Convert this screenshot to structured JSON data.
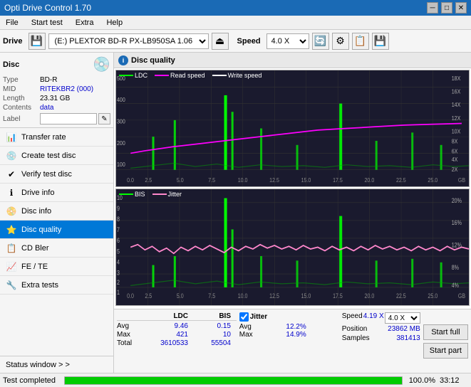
{
  "titlebar": {
    "title": "Opti Drive Control 1.70",
    "min_btn": "─",
    "max_btn": "□",
    "close_btn": "✕"
  },
  "menubar": {
    "items": [
      "File",
      "Start test",
      "Extra",
      "Help"
    ]
  },
  "toolbar": {
    "drive_label": "Drive",
    "drive_value": "(E:) PLEXTOR BD-R  PX-LB950SA 1.06",
    "speed_label": "Speed",
    "speed_value": "4.0 X"
  },
  "sidebar": {
    "disc_title": "Disc",
    "disc_type_label": "Type",
    "disc_type_value": "BD-R",
    "disc_mid_label": "MID",
    "disc_mid_value": "RITEKBR2 (000)",
    "disc_length_label": "Length",
    "disc_length_value": "23.31 GB",
    "disc_contents_label": "Contents",
    "disc_contents_value": "data",
    "disc_label_label": "Label",
    "nav_items": [
      {
        "id": "transfer-rate",
        "label": "Transfer rate",
        "icon": "📊"
      },
      {
        "id": "create-test-disc",
        "label": "Create test disc",
        "icon": "💿"
      },
      {
        "id": "verify-test-disc",
        "label": "Verify test disc",
        "icon": "✔"
      },
      {
        "id": "drive-info",
        "label": "Drive info",
        "icon": "ℹ"
      },
      {
        "id": "disc-info",
        "label": "Disc info",
        "icon": "📀"
      },
      {
        "id": "disc-quality",
        "label": "Disc quality",
        "icon": "⭐",
        "active": true
      },
      {
        "id": "cd-bler",
        "label": "CD Bler",
        "icon": "📋"
      },
      {
        "id": "fe-te",
        "label": "FE / TE",
        "icon": "📈"
      },
      {
        "id": "extra-tests",
        "label": "Extra tests",
        "icon": "🔧"
      }
    ],
    "status_window": "Status window > >"
  },
  "chart": {
    "title": "Disc quality",
    "upper": {
      "legend": [
        {
          "label": "LDC",
          "color": "#00ff00"
        },
        {
          "label": "Read speed",
          "color": "#ff00ff"
        },
        {
          "label": "Write speed",
          "color": "#ffffff"
        }
      ],
      "y_axis": [
        "18X",
        "16X",
        "14X",
        "12X",
        "10X",
        "8X",
        "6X",
        "4X",
        "2X"
      ],
      "y_axis_left": [
        "500",
        "400",
        "300",
        "200",
        "100"
      ],
      "x_axis": [
        "0.0",
        "2.5",
        "5.0",
        "7.5",
        "10.0",
        "12.5",
        "15.0",
        "17.5",
        "20.0",
        "22.5",
        "25.0"
      ],
      "x_label": "GB"
    },
    "lower": {
      "legend": [
        {
          "label": "BIS",
          "color": "#00ff00"
        },
        {
          "label": "Jitter",
          "color": "#ff88cc"
        }
      ],
      "y_axis": [
        "20%",
        "16%",
        "12%",
        "8%",
        "4%"
      ],
      "y_axis_left": [
        "10",
        "9",
        "8",
        "7",
        "6",
        "5",
        "4",
        "3",
        "2",
        "1"
      ],
      "x_axis": [
        "0.0",
        "2.5",
        "5.0",
        "7.5",
        "10.0",
        "12.5",
        "15.0",
        "17.5",
        "20.0",
        "22.5",
        "25.0"
      ],
      "x_label": "GB"
    }
  },
  "stats": {
    "headers": [
      "",
      "LDC",
      "BIS"
    ],
    "rows": [
      {
        "label": "Avg",
        "ldc": "9.46",
        "bis": "0.15"
      },
      {
        "label": "Max",
        "ldc": "421",
        "bis": "10"
      },
      {
        "label": "Total",
        "ldc": "3610533",
        "bis": "55504"
      }
    ],
    "jitter": {
      "checked": true,
      "label": "Jitter",
      "rows": [
        {
          "label": "Avg",
          "val": "12.2%"
        },
        {
          "label": "Max",
          "val": "14.9%"
        }
      ]
    },
    "speed": {
      "label": "Speed",
      "value": "4.19 X",
      "select_value": "4.0 X",
      "position_label": "Position",
      "position_value": "23862 MB",
      "samples_label": "Samples",
      "samples_value": "381413"
    },
    "buttons": {
      "start_full": "Start full",
      "start_part": "Start part"
    }
  },
  "progress": {
    "status": "Test completed",
    "percent": 100,
    "percent_text": "100.0%",
    "time": "33:12"
  }
}
